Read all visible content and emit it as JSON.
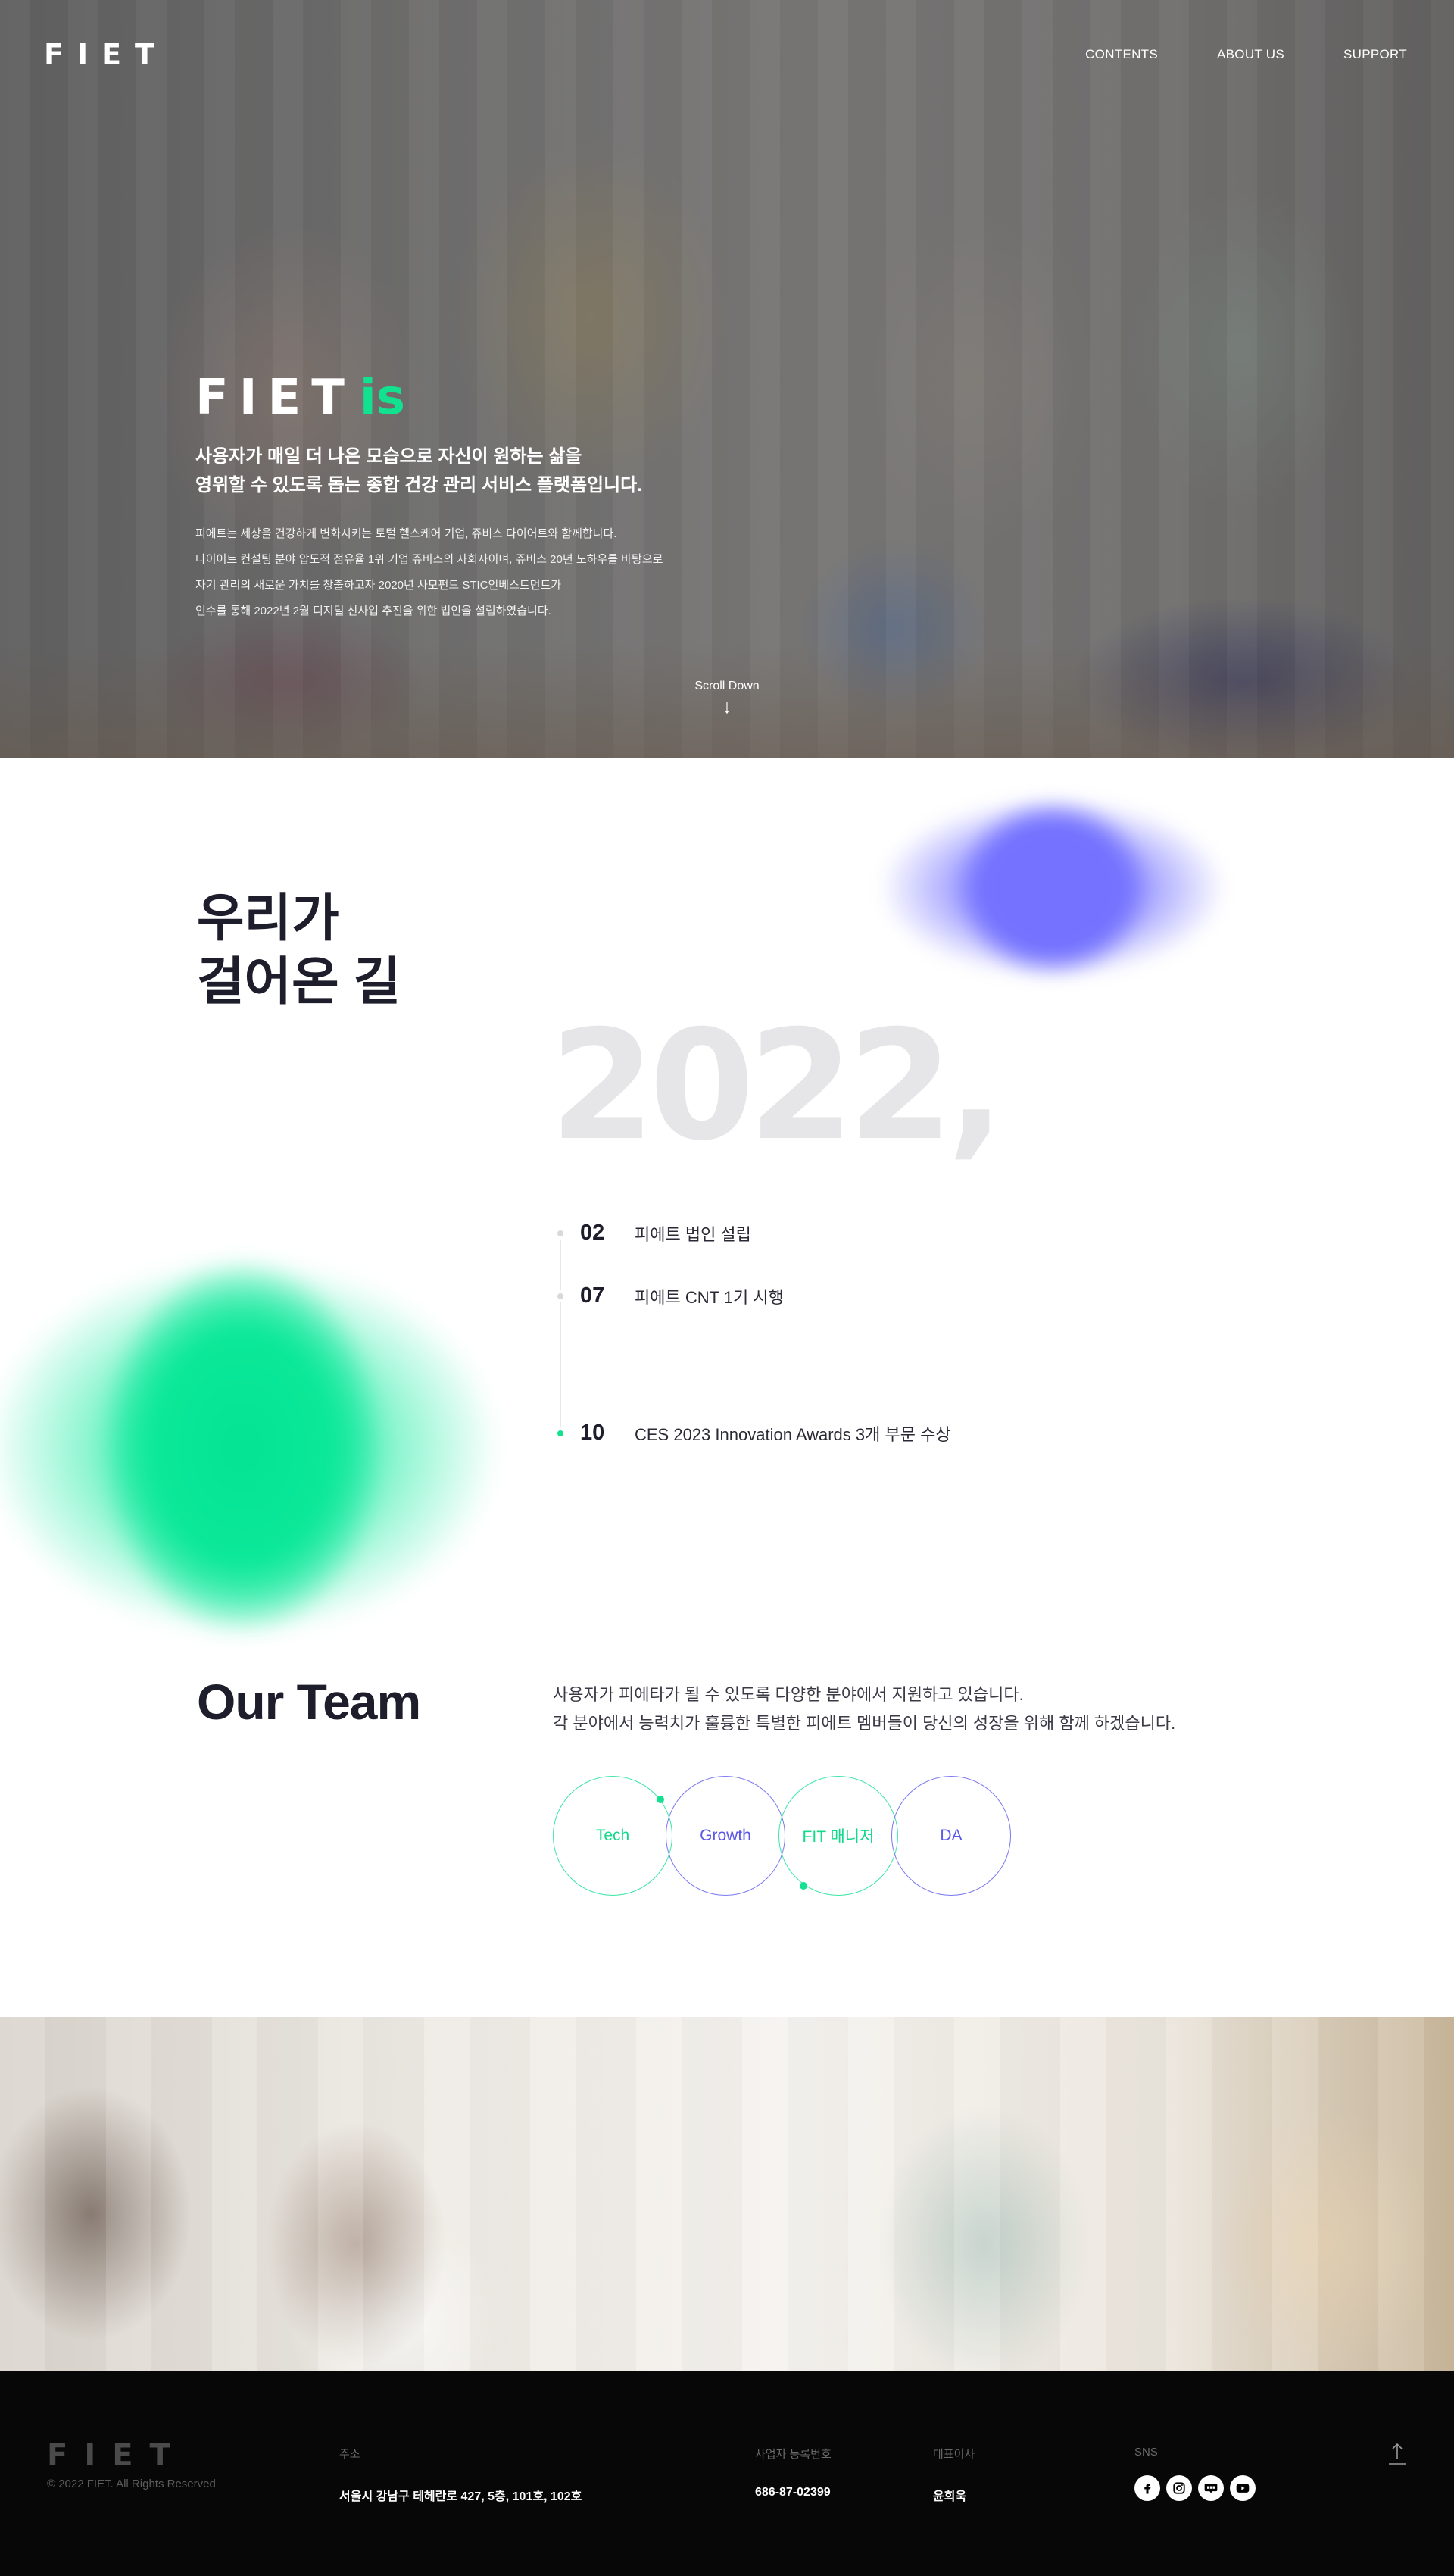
{
  "header": {
    "logo": "FIET",
    "nav": [
      "CONTENTS",
      "ABOUT US",
      "SUPPORT"
    ]
  },
  "hero": {
    "title_main": "FIET",
    "title_accent": "is",
    "lead": [
      "사용자가 매일 더 나은 모습으로 자신이 원하는 삶을",
      "영위할 수 있도록 돕는 종합 건강 관리 서비스 플랫폼입니다."
    ],
    "body": [
      "피에트는 세상을 건강하게 변화시키는 토털 헬스케어 기업, 쥬비스 다이어트와 함께합니다.",
      "다이어트 컨설팅 분야 압도적 점유율 1위 기업 쥬비스의 자회사이며, 쥬비스 20년 노하우를 바탕으로",
      "자기 관리의 새로운 가치를 창출하고자 2020년 사모펀드 STIC인베스트먼트가",
      "인수를 통해 2022년 2월 디지털 신사업 추진을 위한 법인을 설립하였습니다."
    ],
    "scroll_label": "Scroll Down",
    "scroll_arrow": "↓"
  },
  "history": {
    "title": [
      "우리가",
      "걸어온 길"
    ],
    "year": "2022,",
    "items": [
      {
        "month": "02",
        "text": "피에트 법인 설립",
        "active": false
      },
      {
        "month": "07",
        "text": "피에트 CNT 1기 시행",
        "active": false
      },
      {
        "month": "10",
        "text": "CES 2023 Innovation Awards 3개 부문 수상",
        "active": true
      }
    ]
  },
  "team": {
    "title": "Our Team",
    "desc": [
      "사용자가 피에타가 될 수 있도록 다양한 분야에서 지원하고 있습니다.",
      "각 분야에서 능력치가 훌륭한 특별한 피에트 멤버들이 당신의 성장을 위해 함께 하겠습니다."
    ],
    "circles": [
      "Tech",
      "Growth",
      "FIT 매니저",
      "DA"
    ]
  },
  "footer": {
    "logo": "FIET",
    "copyright": "© 2022 FIET. All Rights Reserved",
    "address_label": "주소",
    "address": "서울시 강남구 테헤란로 427, 5층, 101호, 102호",
    "biz_label": "사업자 등록번호",
    "biz_no": "686-87-02399",
    "ceo_label": "대표이사",
    "ceo": "윤희욱",
    "sns_label": "SNS",
    "sns_icons": [
      "facebook-icon",
      "instagram-icon",
      "blog-icon",
      "youtube-icon"
    ]
  },
  "colors": {
    "accent_green": "#12e28f",
    "accent_purple": "#7472ff",
    "footer_bg": "#070707"
  }
}
